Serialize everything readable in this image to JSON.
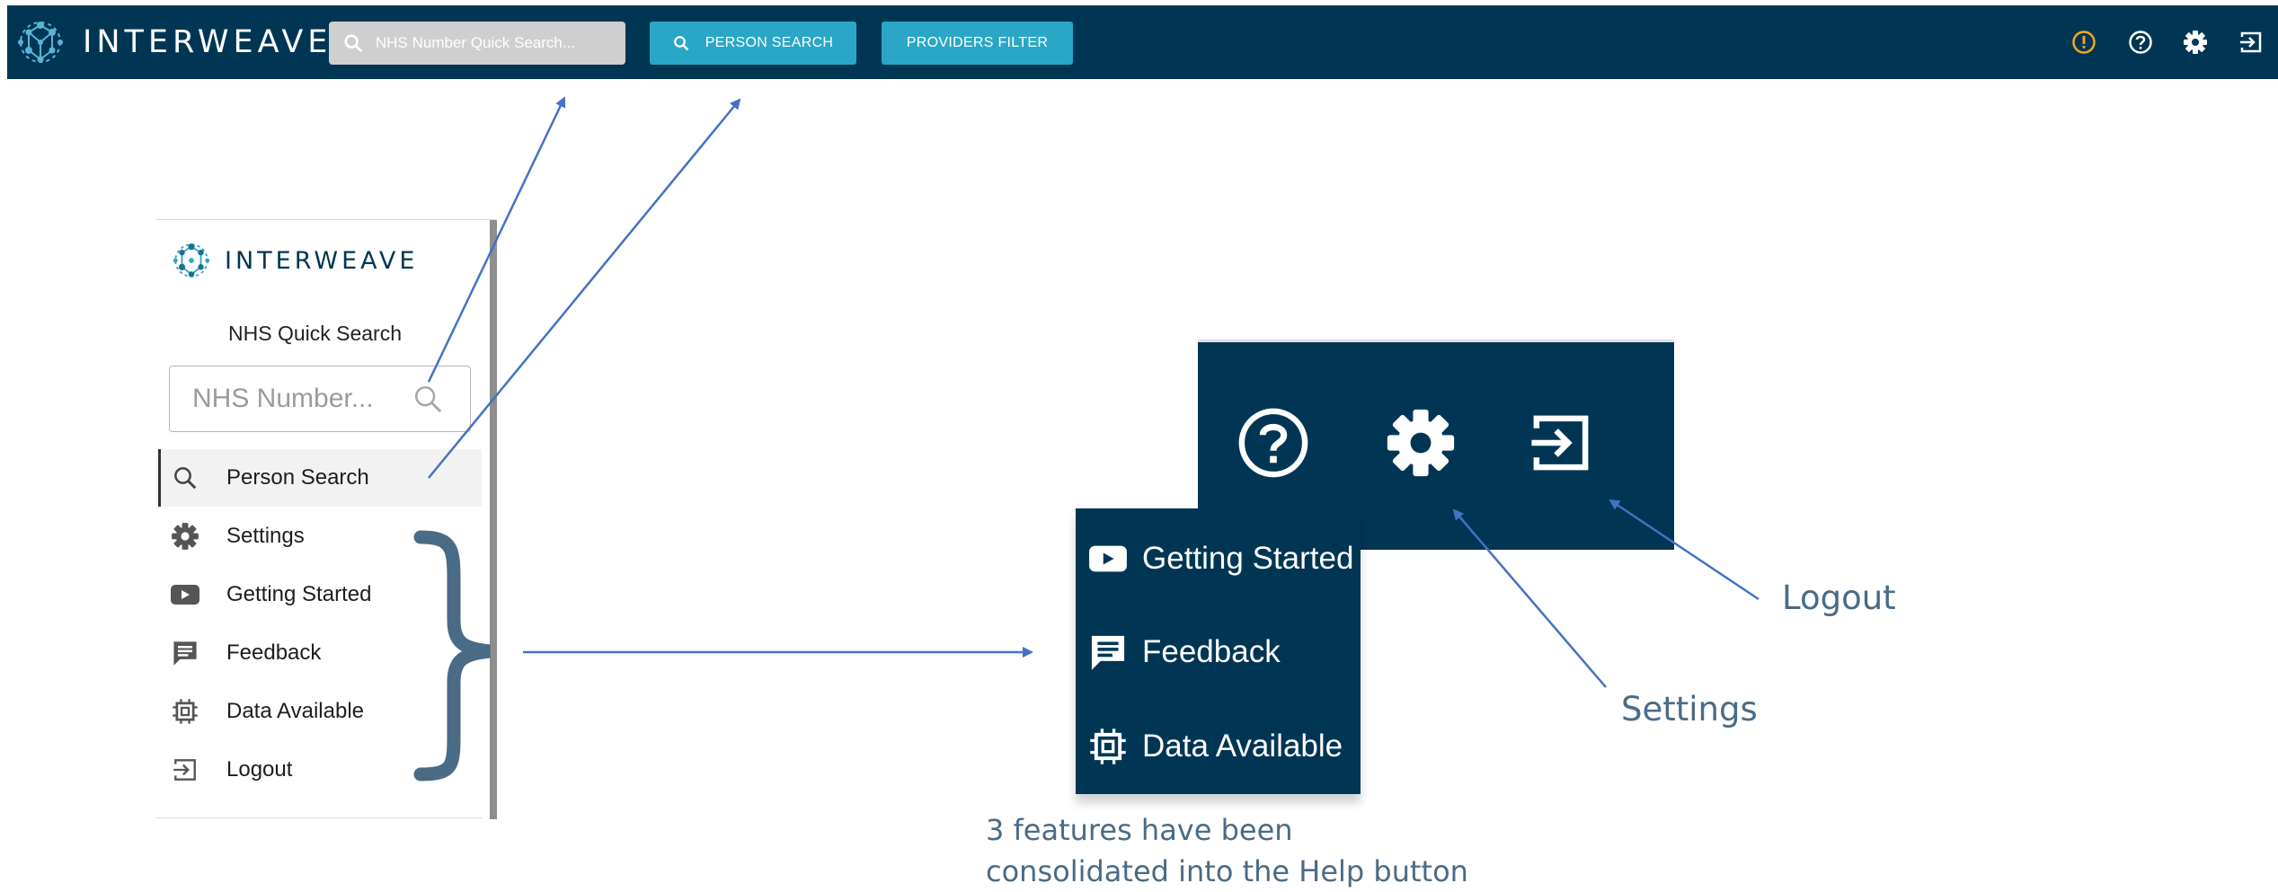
{
  "topbar": {
    "brand": "INTERWEAVE",
    "nhs_search_placeholder": "NHS Number Quick Search...",
    "person_search_label": "PERSON SEARCH",
    "providers_filter_label": "PROVIDERS FILTER",
    "icons": [
      "alert-icon",
      "help-icon",
      "settings-icon",
      "logout-icon"
    ],
    "alert_color": "#f5a623"
  },
  "sidebar": {
    "brand": "INTERWEAVE",
    "quick_search_label": "NHS Quick Search",
    "nhs_input_placeholder": "NHS Number...",
    "items": [
      {
        "label": "Person Search",
        "icon": "search-icon"
      },
      {
        "label": "Settings",
        "icon": "gear-icon"
      },
      {
        "label": "Getting Started",
        "icon": "video-icon"
      },
      {
        "label": "Feedback",
        "icon": "feedback-icon"
      },
      {
        "label": "Data Available",
        "icon": "chip-icon"
      },
      {
        "label": "Logout",
        "icon": "logout-icon"
      }
    ]
  },
  "help_menu": {
    "header_icons": [
      "help-icon",
      "settings-icon",
      "logout-icon"
    ],
    "items": [
      {
        "label": "Getting Started",
        "icon": "video-icon"
      },
      {
        "label": "Feedback",
        "icon": "feedback-icon"
      },
      {
        "label": "Data Available",
        "icon": "chip-icon"
      }
    ]
  },
  "annotations": {
    "logout": "Logout",
    "settings": "Settings",
    "note_line1": "3 features have been",
    "note_line2": "consolidated into the Help button"
  },
  "colors": {
    "navy": "#003654",
    "accent": "#2aa7c6",
    "arrow": "#4472c4",
    "brace": "#4a6b86"
  }
}
